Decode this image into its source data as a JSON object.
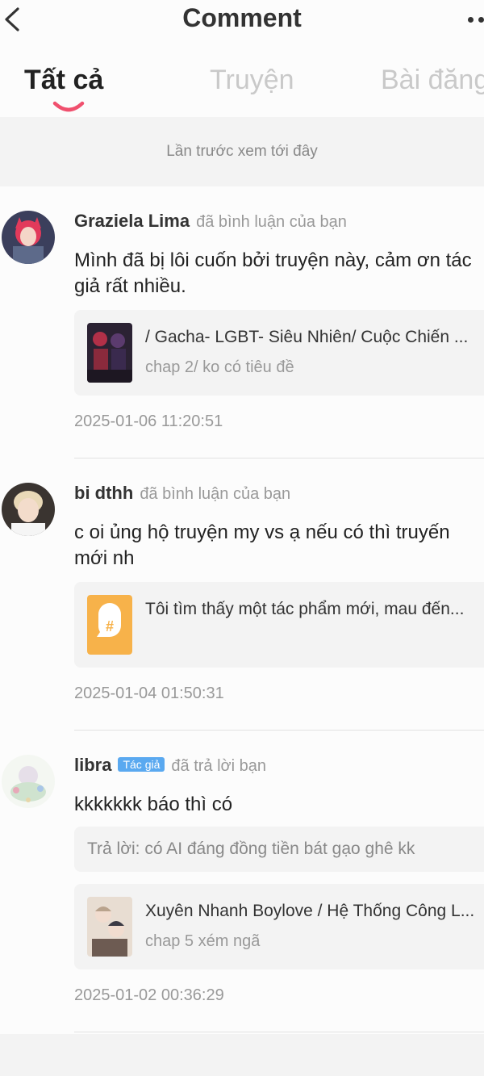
{
  "header": {
    "title": "Comment",
    "back_icon": "chevron-left-icon",
    "more_icon": "more-dots-icon"
  },
  "tabs": [
    {
      "label": "Tất cả",
      "active": true
    },
    {
      "label": "Truyện",
      "active": false
    },
    {
      "label": "Bài đăng",
      "active": false
    }
  ],
  "divider_note": "Lần trước xem tới đây",
  "comments": [
    {
      "user": "Graziela Lima",
      "action": "đã bình luận của bạn",
      "text": "Mình đã bị lôi cuốn bởi truyện này, cảm ơn tác giả rất nhiều.",
      "card": {
        "title": "/ Gacha- LGBT- Siêu Nhiên/ Cuộc Chiến ...",
        "subtitle": "chap 2/ ko có tiêu đề",
        "thumb_kind": "comic-cover"
      },
      "timestamp": "2025-01-06 11:20:51"
    },
    {
      "user": "bi dthh",
      "action": "đã bình luận của bạn",
      "text": "c oi ủng hộ truyện my vs ạ nếu có thì truyến mới nh",
      "card": {
        "title": "Tôi tìm thấy một tác phẩm mới, mau đến...",
        "subtitle": "",
        "thumb_kind": "hashtag-icon"
      },
      "timestamp": "2025-01-04 01:50:31"
    },
    {
      "user": "libra",
      "badge": "Tác giả",
      "action": "đã trả lời bạn",
      "text": "kkkkkkk báo thì có",
      "reply": "Trả lời: có AI đáng đồng tiền bát gạo ghê kk",
      "card": {
        "title": "Xuyên Nhanh Boylove / Hệ Thống Công L...",
        "subtitle": "chap 5 xém ngã",
        "thumb_kind": "comic-cover"
      },
      "timestamp": "2025-01-02 00:36:29"
    }
  ],
  "colors": {
    "accent_underline": "#f0506e",
    "badge_bg": "#5aa9f0",
    "hashtag_tile": "#f7b24a"
  }
}
